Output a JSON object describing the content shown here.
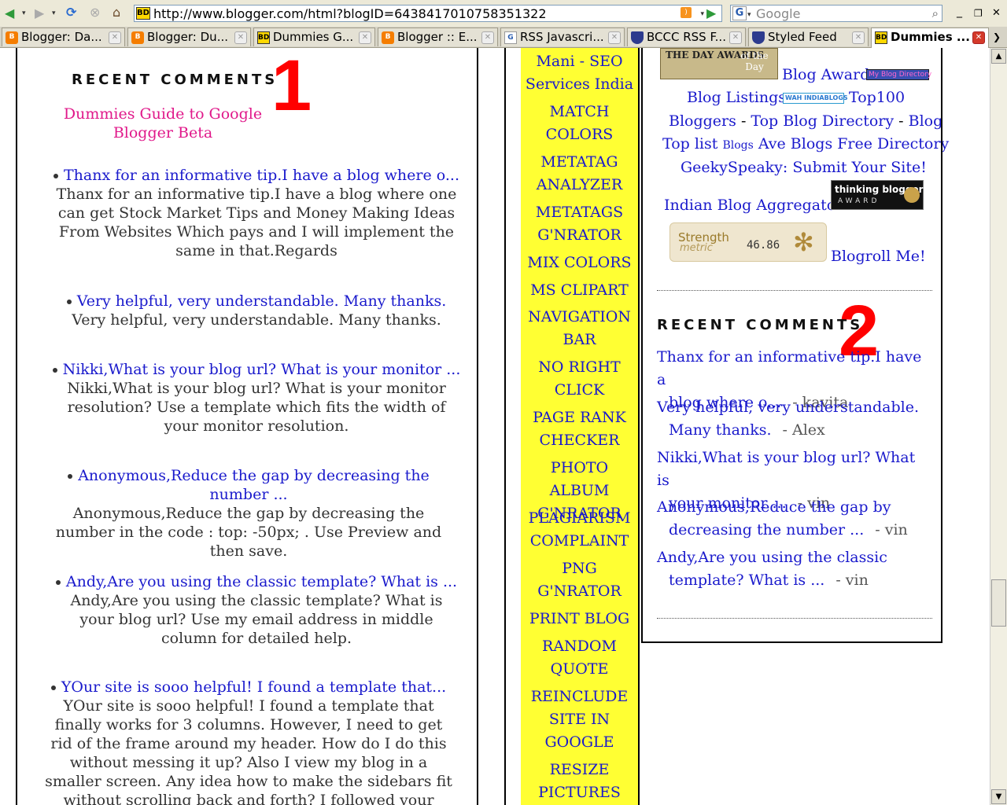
{
  "browser": {
    "url": "http://www.blogger.com/html?blogID=6438417010758351322",
    "search_placeholder": "Google",
    "search_engine_glyph": "G",
    "favicon_text": "BD",
    "icons": {
      "back": "back-arrow-icon",
      "forward": "forward-arrow-icon",
      "reload": "reload-icon",
      "stop": "stop-icon",
      "home": "home-icon",
      "rss": "rss-feed-icon",
      "go": "go-arrow-icon",
      "search": "magnifier-icon"
    },
    "window_controls": {
      "minimize": "_",
      "restore": "❐",
      "close": "✕"
    }
  },
  "tabs": [
    {
      "label": "Blogger: Da...",
      "icon": "blogger",
      "icon_text": "B",
      "active": false
    },
    {
      "label": "Blogger: Du...",
      "icon": "blogger",
      "icon_text": "B",
      "active": false
    },
    {
      "label": "Dummies G...",
      "icon": "bd",
      "icon_text": "BD",
      "active": false
    },
    {
      "label": "Blogger :: E...",
      "icon": "blogger",
      "icon_text": "B",
      "active": false
    },
    {
      "label": "RSS Javascri...",
      "icon": "g",
      "icon_text": "G",
      "active": false
    },
    {
      "label": "BCCC RSS F...",
      "icon": "shield",
      "icon_text": "",
      "active": false
    },
    {
      "label": "Styled Feed",
      "icon": "shield",
      "icon_text": "",
      "active": false
    },
    {
      "label": "Dummies ...",
      "icon": "bd",
      "icon_text": "BD",
      "active": true
    }
  ],
  "left_widget": {
    "title": "RECENT COMMENTS",
    "annotation": "1",
    "feed_title": "Dummies Guide to Google Blogger Beta",
    "comments": [
      {
        "link": "Thanx for an informative tip.I have a blog where o...",
        "body": "Thanx for an informative tip.I have a blog where one can get Stock Market Tips and Money Making Ideas From Websites Which pays and I will implement the same in that.Regards"
      },
      {
        "link": "Very helpful, very understandable. Many thanks.",
        "body": "Very helpful, very understandable. Many thanks."
      },
      {
        "link": "Nikki,What is your blog url? What is your monitor ...",
        "body": "Nikki,What is your blog url? What is your monitor resolution? Use a template which fits the width of your monitor resolution."
      },
      {
        "link": "Anonymous,Reduce the gap by decreasing the number ...",
        "body": "Anonymous,Reduce the gap by decreasing the number in the code : top: -50px; . Use Preview and then save."
      },
      {
        "link": "Andy,Are you using the classic template? What is ...",
        "body": "Andy,Are you using the classic template? What is your blog url? Use my email address in middle column for detailed help."
      },
      {
        "link": "YOur site is sooo helpful! I found a template that...",
        "body": "YOur site is sooo helpful! I found a template that finally works for 3 columns. However, I need to get rid of the frame around my header. How do I do this without messing it up? Also I view my blog in a smaller screen. Any idea how to make the sidebars fit without scrolling back and forth? I followed your guides for changing the"
      }
    ]
  },
  "middle_links": [
    {
      "lines": [
        "Mani - SEO",
        "Services India"
      ]
    },
    {
      "lines": [
        "MATCH",
        "COLORS"
      ]
    },
    {
      "lines": [
        "METATAG",
        "ANALYZER"
      ]
    },
    {
      "lines": [
        "METATAGS",
        "G'NRATOR"
      ]
    },
    {
      "lines": [
        "MIX COLORS"
      ]
    },
    {
      "lines": [
        "MS CLIPART"
      ]
    },
    {
      "lines": [
        "NAVIGATION",
        "BAR"
      ]
    },
    {
      "lines": [
        "NO RIGHT",
        "CLICK"
      ]
    },
    {
      "lines": [
        "PAGE RANK",
        "CHECKER"
      ]
    },
    {
      "lines": [
        "PHOTO ALBUM",
        "G'NRATOR"
      ]
    },
    {
      "lines": [
        "PLAGIARISM",
        "COMPLAINT"
      ]
    },
    {
      "lines": [
        "PNG",
        "G'NRATOR"
      ]
    },
    {
      "lines": [
        "PRINT BLOG"
      ]
    },
    {
      "lines": [
        "RANDOM",
        "QUOTE"
      ]
    },
    {
      "lines": [
        "REINCLUDE",
        "SITE IN",
        "GOOGLE"
      ]
    },
    {
      "lines": [
        "RESIZE",
        "PICTURES"
      ]
    }
  ],
  "right_column": {
    "award_badge_top": "THE DAY AWARDS",
    "award_badge_side": "of the Day",
    "blog_award": "Blog Award",
    "my_blog_directory": "My Blog Directory",
    "blog_listings": "Blog Listings",
    "indiablogs_badge": "WAH INDIABLOGS",
    "top100": "Top100",
    "bloggers": "Bloggers",
    "top_blog_directory": "Top Blog Directory",
    "blog": "Blog",
    "top_list": "Top list",
    "blogs_small": "Blogs",
    "ave_blogs": "Ave Blogs Free Directory",
    "geeky": "GeekySpeaky: Submit Your Site!",
    "indian_aggregator": "Indian Blog Aggregator",
    "thinking_badge_line1": "thinking blogger",
    "thinking_badge_line2": "AWARD",
    "strength_line1": "Strength",
    "strength_line2": "metric",
    "strength_value": "46.86",
    "blogroll": "Blogroll Me!",
    "dash": "-",
    "widget_title": "RECENT COMMENTS",
    "annotation": "2",
    "comments": [
      {
        "line1": "Thanx for an informative tip.I have a",
        "line2": "blog where o...",
        "by": "- kavita"
      },
      {
        "line1": "Very helpful, very understandable.",
        "line2": "Many thanks.",
        "by": "- Alex"
      },
      {
        "line1": "Nikki,What is your blog url? What is",
        "line2": "your monitor ...",
        "by": "- vin"
      },
      {
        "line1": "Anonymous,Reduce the gap by",
        "line2": "decreasing the number ...",
        "by": "- vin"
      },
      {
        "line1": "Andy,Are you using the classic",
        "line2": "template? What is ...",
        "by": "- vin"
      }
    ]
  },
  "colors": {
    "link": "#1a1acc",
    "feed_title": "#e0188a",
    "annotation": "#ff0000",
    "middle_bg": "#ffff33"
  }
}
